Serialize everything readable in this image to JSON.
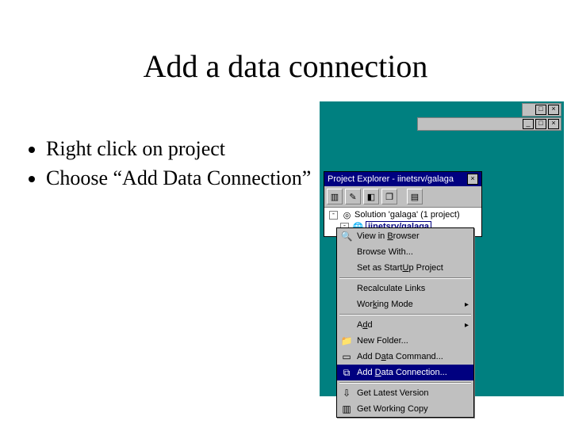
{
  "title": "Add a data connection",
  "bullets": [
    "Right click on project",
    "Choose “Add Data Connection”"
  ],
  "projectExplorer": {
    "title": "Project Explorer - iinetsrv/galaga",
    "solutionLabel": "Solution 'galaga' (1 project)",
    "projectLabel": "iinetsrv/galaga"
  },
  "menu": {
    "viewInBrowser": "View in Browser",
    "browseWith": "Browse With...",
    "setAsStartup": "Set as StartUp Project",
    "recalcLinks": "Recalculate Links",
    "workingMode": "Working Mode",
    "add": "Add",
    "newFolder": "New Folder...",
    "addDataCommand": "Add Data Command...",
    "addDataConnection": "Add Data Connection...",
    "getLatest": "Get Latest Version",
    "getWorkingCopy": "Get Working Copy"
  },
  "winbtns": {
    "min": "_",
    "max": "□",
    "close": "×"
  }
}
